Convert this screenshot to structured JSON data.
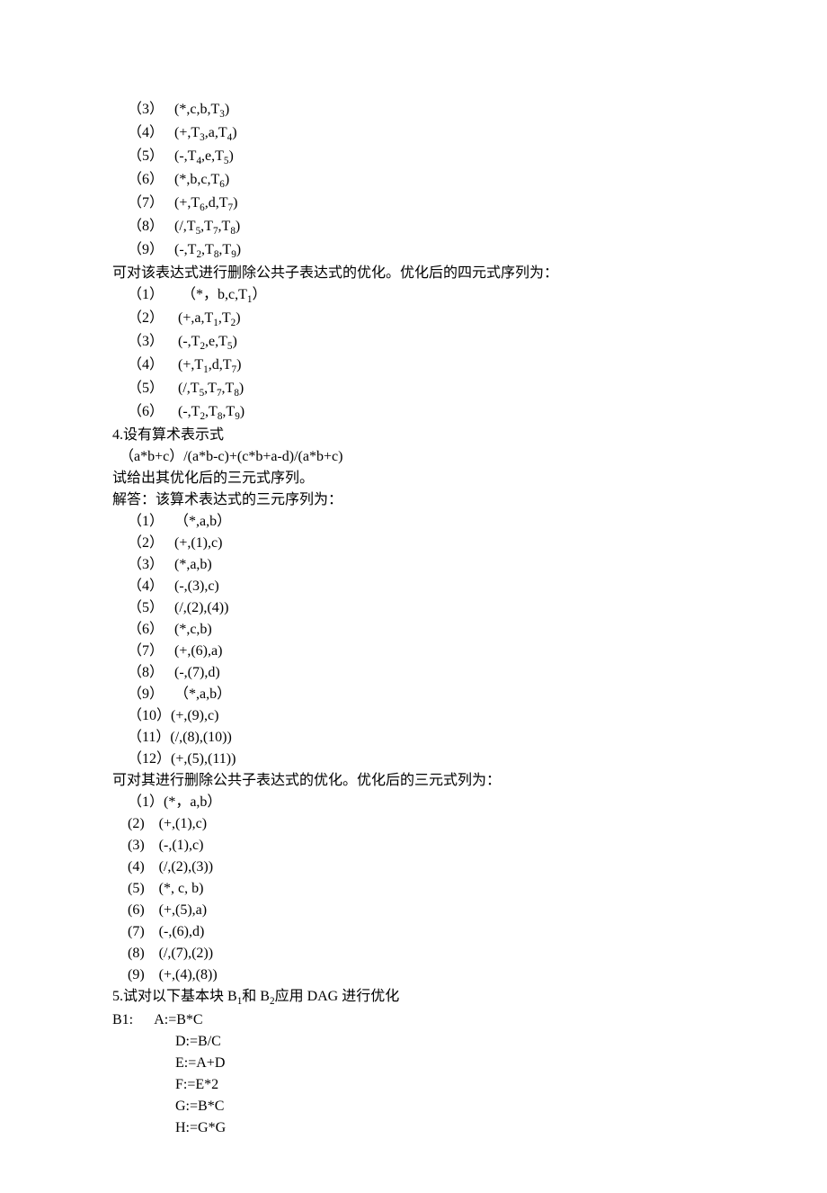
{
  "block_a": [
    {
      "n": "（3）   ",
      "t": "(*,c,b,T",
      "s": "3",
      "r": ")"
    },
    {
      "n": "（4）   ",
      "t": "(+,T",
      "s": "3",
      "m": ",a,T",
      "s2": "4",
      "r": ")"
    },
    {
      "n": "（5）   ",
      "t": "(-,T",
      "s": "4",
      "m": ",e,T",
      "s2": "5",
      "r": ")"
    },
    {
      "n": "（6）   ",
      "t": "(*,b,c,T",
      "s": "6",
      "r": ")"
    },
    {
      "n": "（7）   ",
      "t": "(+,T",
      "s": "6",
      "m": ",d,T",
      "s2": "7",
      "r": ")"
    },
    {
      "n": "（8）   ",
      "t": "(/,T",
      "s": "5",
      "m": ",T",
      "s2": "7",
      "m2": ",T",
      "s3": "8",
      "r": ")"
    },
    {
      "n": "（9）   ",
      "t": "(-,T",
      "s": "2",
      "m": ",T",
      "s2": "8",
      "m2": ",T",
      "s3": "9",
      "r": ")"
    }
  ],
  "text_a": "可对该表达式进行删除公共子表达式的优化。优化后的四元式序列为：",
  "block_b": [
    {
      "n": "（1）     ",
      "t": "（*，b,c,T",
      "s": "1",
      "r": "）"
    },
    {
      "n": "（2）    ",
      "t": "(+,a,T",
      "s": "1",
      "m": ",T",
      "s2": "2",
      "r": ")"
    },
    {
      "n": "（3）    ",
      "t": "(-,T",
      "s": "2",
      "m": ",e,T",
      "s2": "5",
      "r": ")"
    },
    {
      "n": "（4）    ",
      "t": "(+,T",
      "s": "1",
      "m": ",d,T",
      "s2": "7",
      "r": ")"
    },
    {
      "n": "（5）    ",
      "t": "(/,T",
      "s": "5",
      "m": ",T",
      "s2": "7",
      "m2": ",T",
      "s3": "8",
      "r": ")"
    },
    {
      "n": "（6）    ",
      "t": "(-,T",
      "s": "2",
      "m": ",T",
      "s2": "8",
      "m2": ",T",
      "s3": "9",
      "r": ")"
    }
  ],
  "text_q4_1": "4.设有算术表示式",
  "text_q4_2": "  （a*b+c）/(a*b-c)+(c*b+a-d)/(a*b+c)",
  "text_q4_3": "试给出其优化后的三元式序列。",
  "text_q4_4": "解答：该算术表达式的三元序列为：",
  "block_c": [
    "（1）   （*,a,b）",
    "（2）   (+,(1),c)",
    "（3）   (*,a,b)",
    "（4）   (-,(3),c)",
    "（5）   (/,(2),(4))",
    "（6）   (*,c,b)",
    "（7）   (+,(6),a)",
    "（8）   (-,(7),d)",
    "（9）   （*,a,b）",
    "（10）(+,(9),c)",
    "（11）(/,(8),(10))",
    "（12）(+,(5),(11))"
  ],
  "text_d": "可对其进行删除公共子表达式的优化。优化后的三元式列为：",
  "block_d": [
    "（1）(*，a,b）",
    "(2)    (+,(1),c)",
    "(3)    (-,(1),c)",
    "(4)    (/,(2),(3))",
    "(5)    (*, c, b)",
    "(6)    (+,(5),a)",
    "(7)    (-,(6),d)",
    "(8)    (/,(7),(2))",
    "(9)    (+,(4),(8))"
  ],
  "text_q5_pre": "5.试对以下基本块 B",
  "text_q5_s1": "1",
  "text_q5_mid": "和 B",
  "text_q5_s2": "2",
  "text_q5_post": "应用 DAG 进行优化",
  "text_b1": "B1:      A:=B*C",
  "block_e": [
    "D:=B/C",
    "E:=A+D",
    "F:=E*2",
    "G:=B*C",
    "H:=G*G"
  ]
}
